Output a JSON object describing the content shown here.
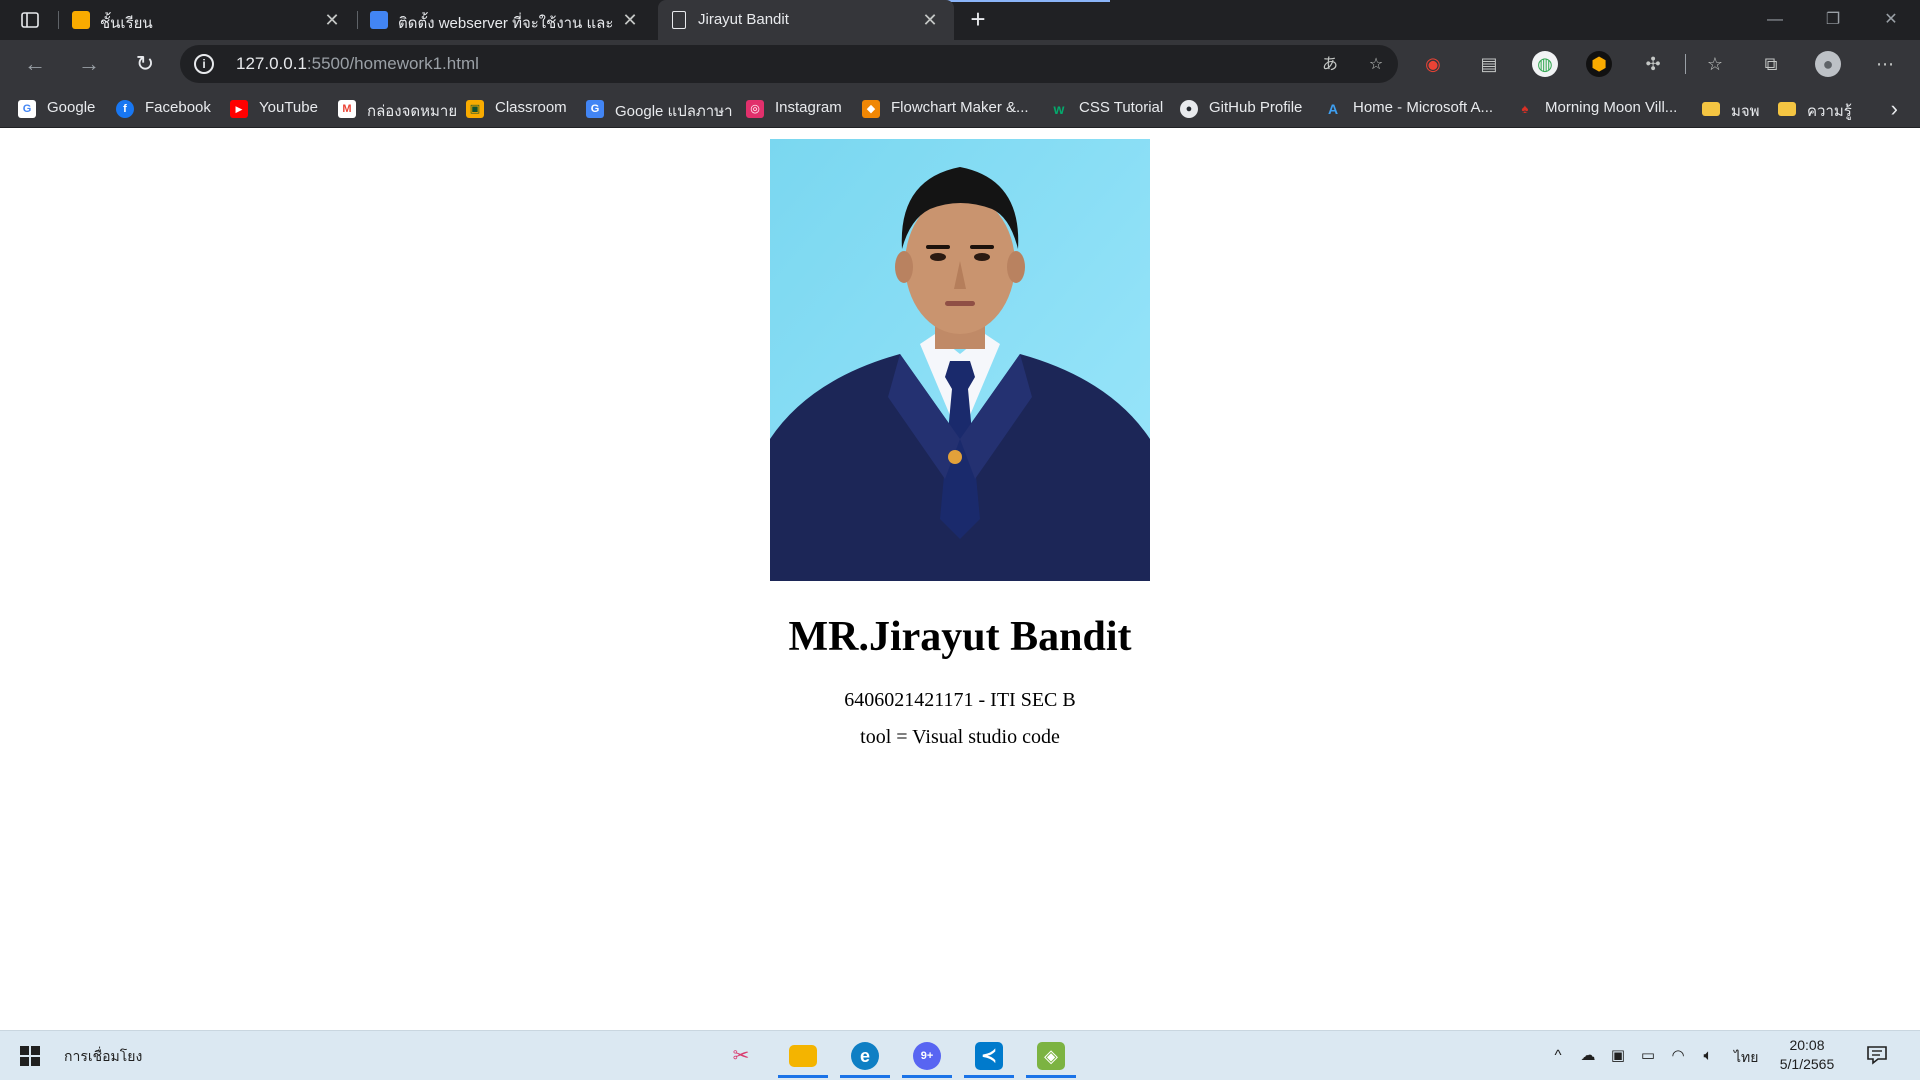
{
  "browser": {
    "tabs": [
      {
        "title": "ชั้นเรียน",
        "favicon": "classroom-icon",
        "color": "#f9ab00"
      },
      {
        "title": "ติดตั้ง webserver ที่จะใช้งาน และ edi",
        "favicon": "person-doc-icon",
        "color": "#4285f4"
      },
      {
        "title": "Jirayut Bandit",
        "favicon": "page-icon",
        "active": true
      }
    ],
    "new_tab_glyph": "+",
    "url_host": "127.0.0.1",
    "url_rest": ":5500/homework1.html"
  },
  "bookmarks": [
    {
      "label": "Google",
      "icon": "google-icon",
      "color": "#4285f4",
      "glyph": "G"
    },
    {
      "label": "Facebook",
      "icon": "facebook-icon",
      "color": "#1877f2",
      "glyph": "f"
    },
    {
      "label": "YouTube",
      "icon": "youtube-icon",
      "color": "#ff0000",
      "glyph": "▶"
    },
    {
      "label": "กล่องจดหมาย",
      "icon": "gmail-icon",
      "color": "#ea4335",
      "glyph": "M"
    },
    {
      "label": "Classroom",
      "icon": "classroom-icon",
      "color": "#f9ab00",
      "glyph": "▣"
    },
    {
      "label": "Google แปลภาษา",
      "icon": "translate-icon",
      "color": "#4285f4",
      "glyph": "G"
    },
    {
      "label": "Instagram",
      "icon": "instagram-icon",
      "color": "#e1306c",
      "glyph": "◎"
    },
    {
      "label": "Flowchart Maker &...",
      "icon": "drawio-icon",
      "color": "#f08705",
      "glyph": "◆"
    },
    {
      "label": "CSS Tutorial",
      "icon": "w3schools-icon",
      "color": "#04aa6d",
      "glyph": "w"
    },
    {
      "label": "GitHub Profile",
      "icon": "github-icon",
      "color": "#24292f",
      "glyph": "●"
    },
    {
      "label": "Home - Microsoft A...",
      "icon": "azure-icon",
      "color": "#0078d4",
      "glyph": "A"
    },
    {
      "label": "Morning Moon Vill...",
      "icon": "mushroom-icon",
      "color": "#d93025",
      "glyph": "♠"
    },
    {
      "label": "มจพ",
      "icon": "folder-icon",
      "color": "#f4c542",
      "glyph": ""
    },
    {
      "label": "ความรู้",
      "icon": "folder-icon",
      "color": "#f4c542",
      "glyph": ""
    }
  ],
  "page": {
    "heading": "MR.Jirayut Bandit",
    "student_line": "6406021421171 - ITI SEC B",
    "tool_line": "tool = Visual studio code"
  },
  "taskbar": {
    "search_text": "การเชื่อมโยง",
    "language": "ไทย",
    "time": "20:08",
    "date": "5/1/2565",
    "apps": [
      {
        "name": "snip-sketch-icon",
        "color": "#e8eaed",
        "glyph": "✂",
        "running": false
      },
      {
        "name": "file-explorer-icon",
        "color": "#f4b400",
        "glyph": "▬",
        "running": true
      },
      {
        "name": "edge-icon",
        "color": "#0f7fc4",
        "glyph": "e",
        "running": true
      },
      {
        "name": "discord-icon",
        "color": "#5865f2",
        "glyph": "9+",
        "running": true
      },
      {
        "name": "vscode-icon",
        "color": "#007acc",
        "glyph": "≺",
        "running": true
      },
      {
        "name": "bluestacks-icon",
        "color": "#7cb342",
        "glyph": "◈",
        "running": true
      }
    ]
  }
}
